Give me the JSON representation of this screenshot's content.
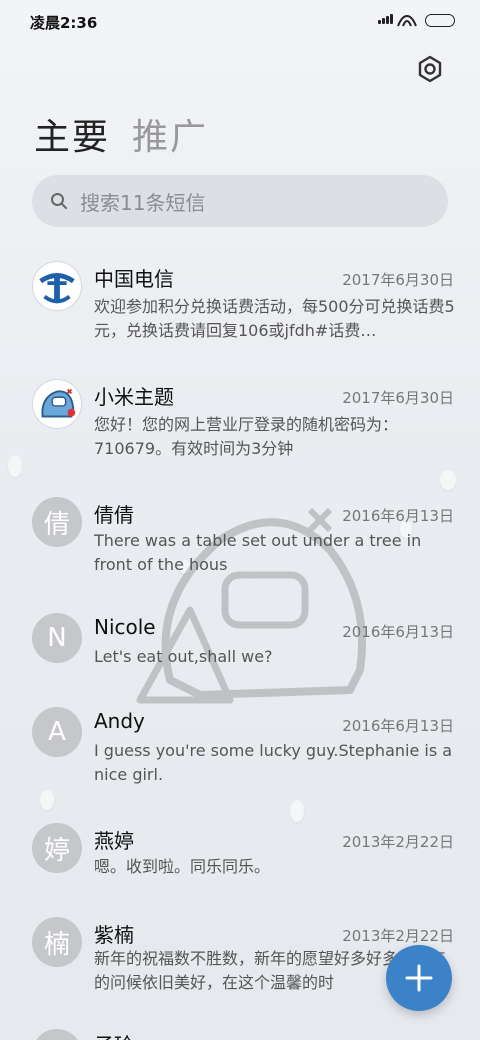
{
  "status_bar": {
    "time": "凌晨2:36"
  },
  "tabs": [
    {
      "label": "主要",
      "active": true
    },
    {
      "label": "推广",
      "active": false
    }
  ],
  "search": {
    "placeholder": "搜索11条短信"
  },
  "conversations": [
    {
      "name": "中国电信",
      "date": "2017年6月30日",
      "preview": "欢迎参加积分兑换话费活动，每500分可兑换话费5元，兑换话费请回复106或jfdh#话费…",
      "avatar": "telecom-logo"
    },
    {
      "name": "小米主题",
      "date": "2017年6月30日",
      "preview": "您好！您的网上营业厅登录的随机密码为：710679。有效时间为3分钟",
      "avatar": "theme-logo"
    },
    {
      "name": "倩倩",
      "date": "2016年6月13日",
      "preview": "There was a table set out under a tree in front of the hous",
      "avatar": "倩"
    },
    {
      "name": "Nicole",
      "date": "2016年6月13日",
      "preview": "Let's eat out,shall we?",
      "avatar": "N"
    },
    {
      "name": "Andy",
      "date": "2016年6月13日",
      "preview": "I guess you're some lucky guy.Stephanie is a nice girl.",
      "avatar": "A"
    },
    {
      "name": "燕婷",
      "date": "2013年2月22日",
      "preview": "嗯。收到啦。同乐同乐。",
      "avatar": "婷"
    },
    {
      "name": "紫楠",
      "date": "2013年2月22日",
      "preview": "新年的祝福数不胜数，新年的愿望好多好多，新年的问候依旧美好，在这个温馨的时",
      "avatar": "楠"
    },
    {
      "name": "子玲",
      "date": "",
      "preview": "",
      "avatar": "玲"
    }
  ],
  "colors": {
    "accent": "#3b82c8",
    "avatar_gray": "#c5c7cb",
    "telecom_blue": "#1d5fab"
  }
}
